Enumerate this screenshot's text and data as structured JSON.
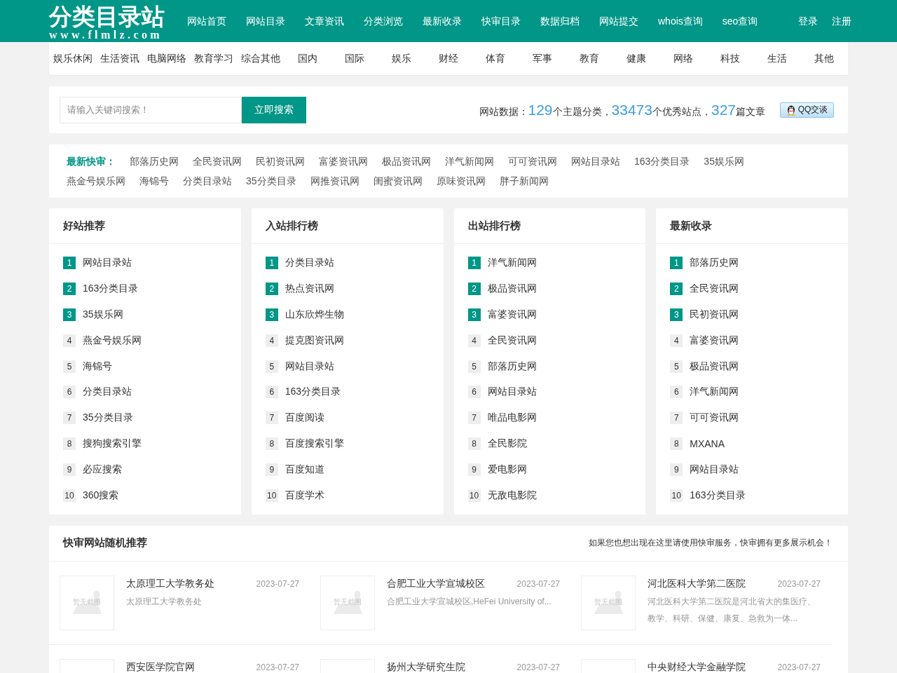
{
  "header": {
    "logo": {
      "title": "分类目录站",
      "url": "www.flmlz.com"
    },
    "nav": [
      "网站首页",
      "网站目录",
      "文章资讯",
      "分类浏览",
      "最新收录",
      "快审目录",
      "数据归档",
      "网站提交",
      "whois查询",
      "seo查询"
    ],
    "account_links": [
      "登录",
      "注册"
    ]
  },
  "categories": [
    "娱乐休闲",
    "生活资讯",
    "电脑网络",
    "教育学习",
    "综合其他",
    "国内",
    "国际",
    "娱乐",
    "财经",
    "体育",
    "军事",
    "教育",
    "健康",
    "网络",
    "科技",
    "生活",
    "其他"
  ],
  "search": {
    "placeholder": "请输入关键词搜索！",
    "button": "立即搜索"
  },
  "stats": {
    "label": "网站数据：",
    "figures": [
      {
        "value": "129",
        "unit": "个主题分类，"
      },
      {
        "value": "33473",
        "unit": "个优秀站点，"
      },
      {
        "value": "327",
        "unit": "篇文章"
      }
    ]
  },
  "qq_button": "QQ交谈",
  "quick_review": {
    "label": "最新快审：",
    "links": [
      "部落历史网",
      "全民资讯网",
      "民初资讯网",
      "富婆资讯网",
      "极品资讯网",
      "洋气新闻网",
      "可可资讯网",
      "网站目录站",
      "163分类目录",
      "35娱乐网",
      "燕金号娱乐网",
      "海锦号",
      "分类目录站",
      "35分类目录",
      "网推资讯网",
      "闺蜜资讯网",
      "原味资讯网",
      "胖子新闻网"
    ]
  },
  "rank_panels": [
    {
      "title": "好站推荐",
      "items": [
        {
          "rank": "1",
          "name": "网站目录站",
          "highlighted": true
        },
        {
          "rank": "2",
          "name": "163分类目录",
          "highlighted": true
        },
        {
          "rank": "3",
          "name": "35娱乐网",
          "highlighted": true
        },
        {
          "rank": "4",
          "name": "燕金号娱乐网",
          "highlighted": false
        },
        {
          "rank": "5",
          "name": "海锦号",
          "highlighted": false
        },
        {
          "rank": "6",
          "name": "分类目录站",
          "highlighted": false
        },
        {
          "rank": "7",
          "name": "35分类目录",
          "highlighted": false
        },
        {
          "rank": "8",
          "name": "搜狗搜索引擎",
          "highlighted": false
        },
        {
          "rank": "9",
          "name": "必应搜索",
          "highlighted": false
        },
        {
          "rank": "10",
          "name": "360搜索",
          "highlighted": false
        }
      ]
    },
    {
      "title": "入站排行榜",
      "items": [
        {
          "rank": "1",
          "name": "分类目录站",
          "highlighted": true
        },
        {
          "rank": "2",
          "name": "热点资讯网",
          "highlighted": true
        },
        {
          "rank": "3",
          "name": "山东欣烨生物",
          "highlighted": true
        },
        {
          "rank": "4",
          "name": "提克图资讯网",
          "highlighted": false
        },
        {
          "rank": "5",
          "name": "网站目录站",
          "highlighted": false
        },
        {
          "rank": "6",
          "name": "163分类目录",
          "highlighted": false
        },
        {
          "rank": "7",
          "name": "百度阅读",
          "highlighted": false
        },
        {
          "rank": "8",
          "name": "百度搜索引擎",
          "highlighted": false
        },
        {
          "rank": "9",
          "name": "百度知道",
          "highlighted": false
        },
        {
          "rank": "10",
          "name": "百度学术",
          "highlighted": false
        }
      ]
    },
    {
      "title": "出站排行榜",
      "items": [
        {
          "rank": "1",
          "name": "洋气新闻网",
          "highlighted": true
        },
        {
          "rank": "2",
          "name": "极品资讯网",
          "highlighted": true
        },
        {
          "rank": "3",
          "name": "富婆资讯网",
          "highlighted": true
        },
        {
          "rank": "4",
          "name": "全民资讯网",
          "highlighted": false
        },
        {
          "rank": "5",
          "name": "部落历史网",
          "highlighted": false
        },
        {
          "rank": "6",
          "name": "网站目录站",
          "highlighted": false
        },
        {
          "rank": "7",
          "name": "唯品电影网",
          "highlighted": false
        },
        {
          "rank": "8",
          "name": "全民影院",
          "highlighted": false
        },
        {
          "rank": "9",
          "name": "爱电影网",
          "highlighted": false
        },
        {
          "rank": "10",
          "name": "无敌电影院",
          "highlighted": false
        }
      ]
    },
    {
      "title": "最新收录",
      "items": [
        {
          "rank": "1",
          "name": "部落历史网",
          "highlighted": true
        },
        {
          "rank": "2",
          "name": "全民资讯网",
          "highlighted": true
        },
        {
          "rank": "3",
          "name": "民初资讯网",
          "highlighted": true
        },
        {
          "rank": "4",
          "name": "富婆资讯网",
          "highlighted": false
        },
        {
          "rank": "5",
          "name": "极品资讯网",
          "highlighted": false
        },
        {
          "rank": "6",
          "name": "洋气新闻网",
          "highlighted": false
        },
        {
          "rank": "7",
          "name": "可可资讯网",
          "highlighted": false
        },
        {
          "rank": "8",
          "name": "MXANA",
          "highlighted": false
        },
        {
          "rank": "9",
          "name": "网站目录站",
          "highlighted": false
        },
        {
          "rank": "10",
          "name": "163分类目录",
          "highlighted": false
        }
      ]
    }
  ],
  "random_sites": {
    "title": "快审网站随机推荐",
    "note": "如果您也想出现在这里请使用快审服务，快审拥有更多展示机会！",
    "rows": [
      {
        "sites": [
          {
            "title": "太原理工大学教务处",
            "date": "2023-07-27",
            "description": "太原理工大学教务处",
            "thumbnail": {
              "caption": "暂无截图"
            }
          },
          {
            "title": "合肥工业大学宣城校区",
            "date": "2023-07-27",
            "description": "合肥工业大学宣城校区,HeFei University of...",
            "thumbnail": {
              "caption": "暂无截图"
            }
          },
          {
            "title": "河北医科大学第二医院",
            "date": "2023-07-27",
            "description": "河北医科大学第二医院是河北省大的集医疗、教学、科研、保健、康复、急救为一体...",
            "thumbnail": {
              "caption": "暂无截图"
            }
          }
        ]
      },
      {
        "sites": [
          {
            "title": "西安医学院官网",
            "date": "2023-07-27"
          },
          {
            "title": "扬州大学研究生院",
            "date": "2023-07-27"
          },
          {
            "title": "中央财经大学金融学院",
            "date": "2023-07-27"
          }
        ]
      }
    ]
  }
}
